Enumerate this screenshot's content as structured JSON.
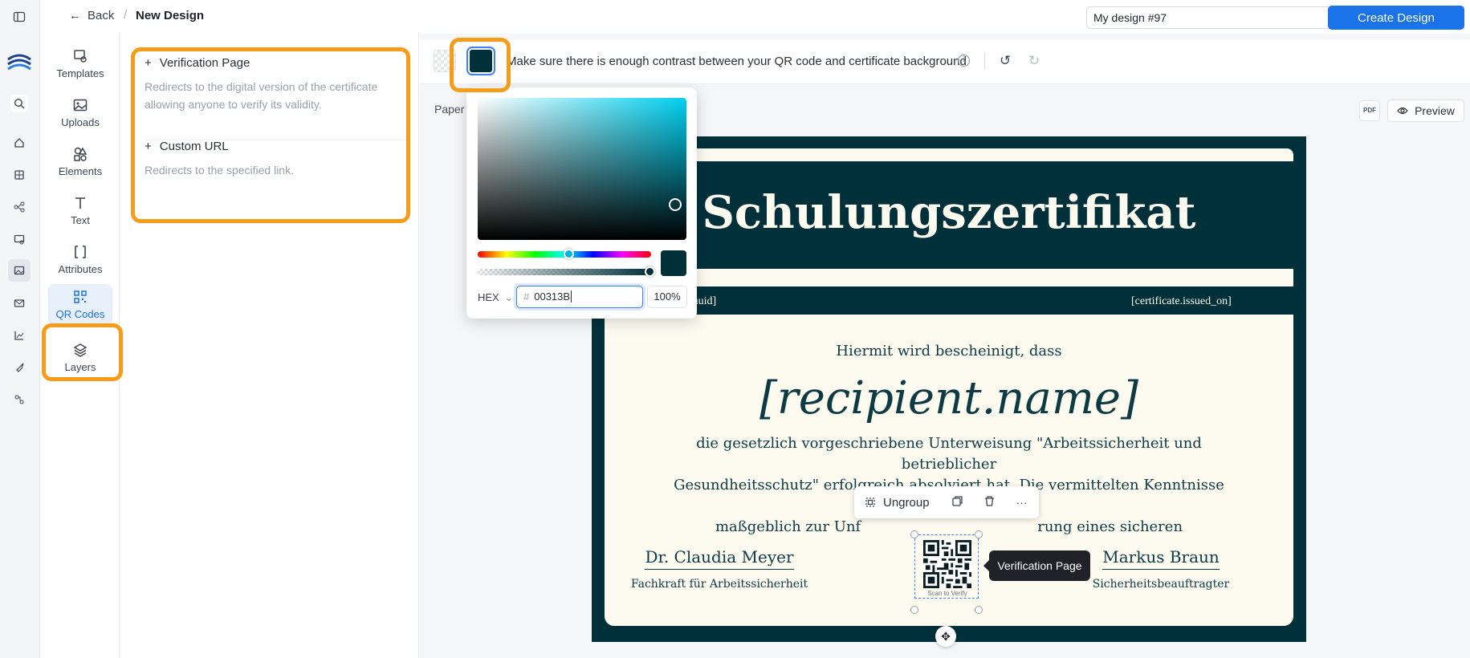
{
  "header": {
    "back_label": "Back",
    "separator": "/",
    "page_title": "New Design",
    "design_name_value": "My design #97",
    "create_label": "Create Design"
  },
  "rail": {
    "icons": [
      "sidebar-toggle-icon",
      "logo",
      "search-icon",
      "home-icon",
      "grid-icon",
      "workflow-icon",
      "certificate-icon",
      "image-icon",
      "mail-icon",
      "chart-icon",
      "rocket-icon",
      "integration-icon"
    ]
  },
  "tools": [
    {
      "label": "Templates",
      "icon": "templates-icon"
    },
    {
      "label": "Uploads",
      "icon": "uploads-icon"
    },
    {
      "label": "Elements",
      "icon": "elements-icon"
    },
    {
      "label": "Text",
      "icon": "text-icon"
    },
    {
      "label": "Attributes",
      "icon": "attributes-icon"
    },
    {
      "label": "QR Codes",
      "icon": "qr-code-icon",
      "active": true
    },
    {
      "label": "Layers",
      "icon": "layers-icon"
    }
  ],
  "panel": {
    "options": [
      {
        "title": "Verification Page",
        "description": "Redirects to the digital version of the certificate allowing anyone to verify its validity."
      },
      {
        "title": "Custom URL",
        "description": "Redirects to the specified link."
      }
    ]
  },
  "toolbar": {
    "contrast_text": "Make sure there is enough contrast between your QR code and certificate background",
    "selected_color": "#00313B"
  },
  "canvas": {
    "paper_label": "Paper",
    "pdf_label": "PDF",
    "preview_label": "Preview"
  },
  "picker": {
    "format_label": "HEX",
    "hex_value": "00313B",
    "alpha_value": "100%"
  },
  "certificate": {
    "title": "Schulungszertifikat",
    "uuid_text": "te.uuid]",
    "issued_text": "[certificate.issued_on]",
    "intro": "Hiermit wird bescheinigt, dass",
    "recipient": "[recipient.name]",
    "paragraph_line1": "die gesetzlich vorgeschriebene Unterweisung \"Arbeitssicherheit und betrieblicher",
    "paragraph_line2": "Gesundheitsschutz\" erfolgreich absolviert hat. Die vermittelten Kenntnisse tragen",
    "paragraph_line3": "maßgeblich zur Unf",
    "paragraph_line3_end": "rung eines sicheren",
    "signer1_name": "Dr. Claudia Meyer",
    "signer1_role": "Fachkraft für Arbeitssicherheit",
    "signer2_name": "Markus Braun",
    "signer2_role": "Sicherheitsbeauftragter",
    "qr_caption": "Scan to Verify"
  },
  "floating_toolbar": {
    "ungroup_label": "Ungroup"
  },
  "tooltip": {
    "label": "Verification Page"
  },
  "colors": {
    "accent": "#1a73e8",
    "highlight": "#f59c1a",
    "certificate_dark": "#00313b",
    "certificate_cream": "#fdfbf0"
  }
}
